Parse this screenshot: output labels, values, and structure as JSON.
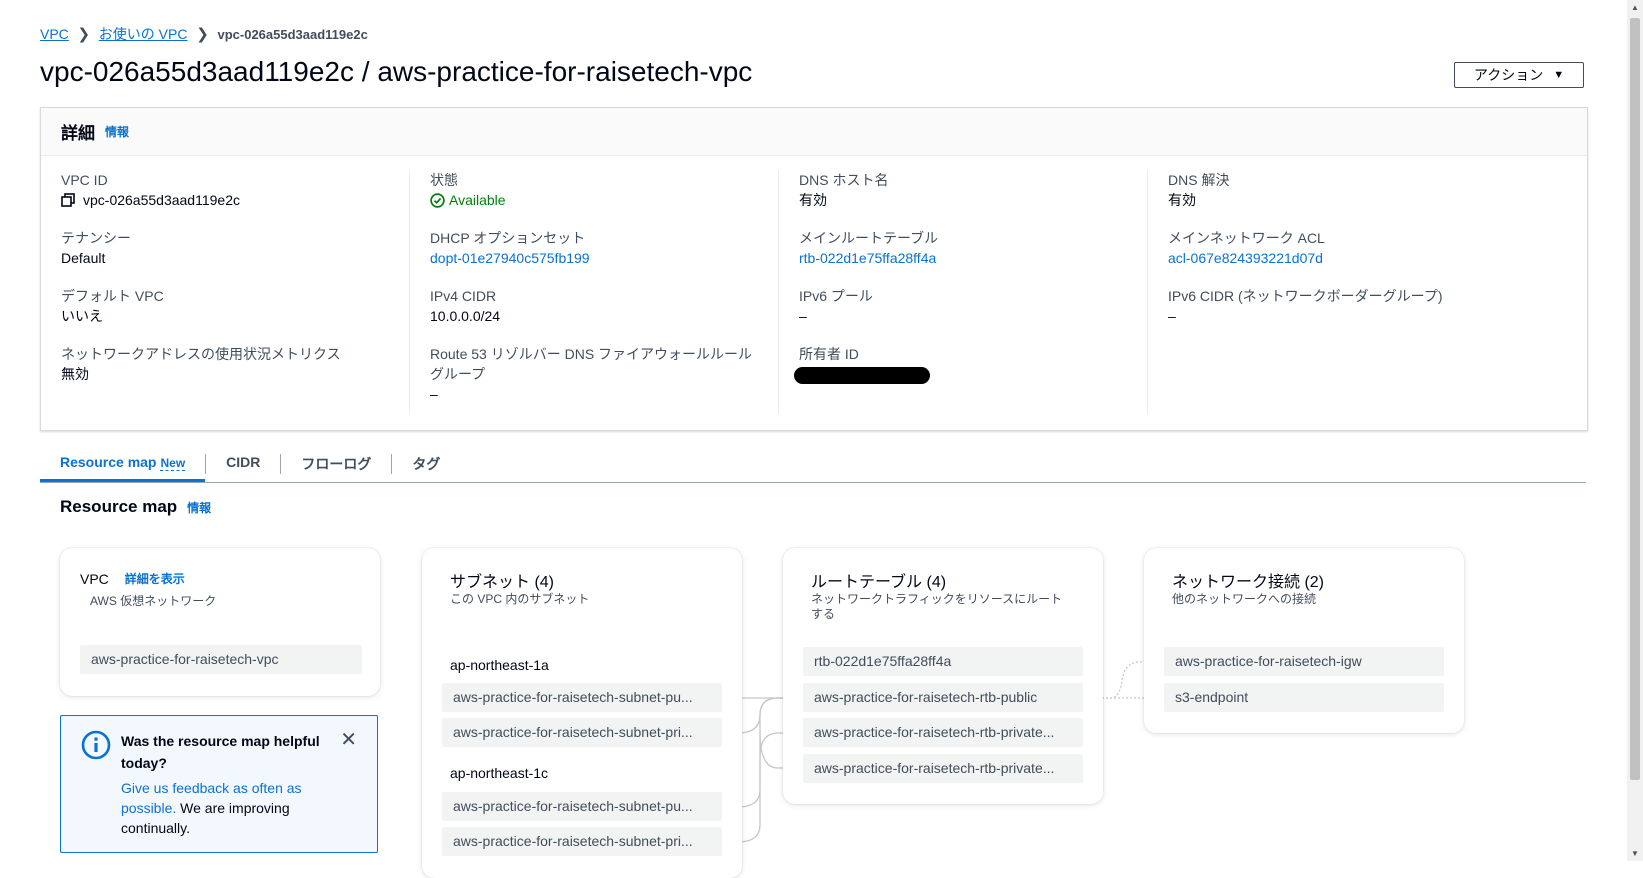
{
  "breadcrumb": {
    "items": [
      "VPC",
      "お使いの VPC"
    ],
    "current": "vpc-026a55d3aad119e2c"
  },
  "page": {
    "title": "vpc-026a55d3aad119e2c / aws-practice-for-raisetech-vpc",
    "action_label": "アクション"
  },
  "details": {
    "header": "詳細",
    "info_label": "情報",
    "columns": [
      [
        {
          "label": "VPC ID",
          "value": "vpc-026a55d3aad119e2c"
        },
        {
          "label": "テナンシー",
          "value": "Default"
        },
        {
          "label": "デフォルト VPC",
          "value": "いいえ"
        },
        {
          "label": "ネットワークアドレスの使用状況メトリクス",
          "value": "無効"
        }
      ],
      [
        {
          "label": "状態",
          "value": "Available"
        },
        {
          "label": "DHCP オプションセット",
          "value": "dopt-01e27940c575fb199"
        },
        {
          "label": "IPv4 CIDR",
          "value": "10.0.0.0/24"
        },
        {
          "label": "Route 53 リゾルバー DNS ファイアウォールルールグループ",
          "value": "–"
        }
      ],
      [
        {
          "label": "DNS ホスト名",
          "value": "有効"
        },
        {
          "label": "メインルートテーブル",
          "value": "rtb-022d1e75ffa28ff4a"
        },
        {
          "label": "IPv6 プール",
          "value": "–"
        },
        {
          "label": "所有者 ID",
          "value": ""
        }
      ],
      [
        {
          "label": "DNS 解決",
          "value": "有効"
        },
        {
          "label": "メインネットワーク ACL",
          "value": "acl-067e824393221d07d"
        },
        {
          "label": "IPv6 CIDR (ネットワークボーダーグループ)",
          "value": "–"
        }
      ]
    ]
  },
  "tabs": [
    {
      "label": "Resource map",
      "badge": "New"
    },
    {
      "label": "CIDR"
    },
    {
      "label": "フローログ"
    },
    {
      "label": "タグ"
    }
  ],
  "resource_map": {
    "title": "Resource map",
    "info_label": "情報",
    "vpc": {
      "title": "VPC",
      "link": "詳細を表示",
      "subtitle": "AWS 仮想ネットワーク",
      "node": "aws-practice-for-raisetech-vpc"
    },
    "subnets": {
      "title": "サブネット (4)",
      "subtitle": "この VPC 内のサブネット",
      "zones": [
        {
          "name": "ap-northeast-1a",
          "items": [
            "aws-practice-for-raisetech-subnet-pu...",
            "aws-practice-for-raisetech-subnet-pri..."
          ]
        },
        {
          "name": "ap-northeast-1c",
          "items": [
            "aws-practice-for-raisetech-subnet-pu...",
            "aws-practice-for-raisetech-subnet-pri..."
          ]
        }
      ]
    },
    "route_tables": {
      "title": "ルートテーブル (4)",
      "subtitle": "ネットワークトラフィックをリソースにルートする",
      "items": [
        "rtb-022d1e75ffa28ff4a",
        "aws-practice-for-raisetech-rtb-public",
        "aws-practice-for-raisetech-rtb-private...",
        "aws-practice-for-raisetech-rtb-private..."
      ]
    },
    "connections": {
      "title": "ネットワーク接続 (2)",
      "subtitle": "他のネットワークへの接続",
      "items": [
        "aws-practice-for-raisetech-igw",
        "s3-endpoint"
      ]
    }
  },
  "feedback": {
    "title": "Was the resource map helpful today?",
    "link": "Give us feedback as often as possible.",
    "rest": " We are improving continually."
  },
  "colors": {
    "link": "#0972d3",
    "success": "#037f0c",
    "text": "#000716",
    "muted": "#414d5c"
  }
}
